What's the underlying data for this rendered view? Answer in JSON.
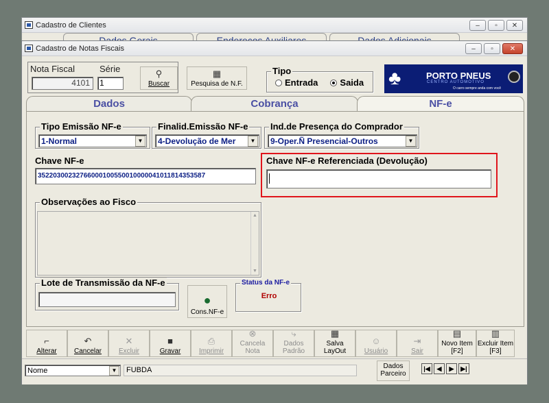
{
  "outer_window": {
    "title": "Cadastro de Clientes",
    "bg_tabs": [
      "Dados Gerais",
      "Endereços Auxiliares",
      "Dados Adicionais"
    ]
  },
  "inner_window": {
    "title": "Cadastro de Notas Fiscais"
  },
  "header": {
    "nota_fiscal_label": "Nota Fiscal",
    "nota_fiscal_value": "4101",
    "serie_label": "Série",
    "serie_value": "1",
    "buscar_label": "Buscar",
    "pesquisa_label": "Pesquisa de N.F.",
    "tipo_label": "Tipo",
    "tipo_options": [
      "Entrada",
      "Saida"
    ],
    "tipo_selected": "Saida",
    "logo_text": "PORTO PNEUS",
    "logo_subtext": "CENTRO AUTOMOTIVO",
    "logo_tagline": "O carro sempre anda com você"
  },
  "tabs": [
    "Dados",
    "Cobrança",
    "NF-e"
  ],
  "active_tab": "NF-e",
  "nfe": {
    "tipo_emissao_label": "Tipo Emissão NF-e",
    "tipo_emissao_value": "1-Normal",
    "finalidade_label": "Finalid.Emissão NF-e",
    "finalidade_value": "4-Devolução de Mer",
    "presenca_label": "Ind.de Presença do Comprador",
    "presenca_value": "9-Oper.Ñ Presencial-Outros",
    "chave_label": "Chave NF-e",
    "chave_value": "35220300232766000100550010000041011814353587",
    "chave_ref_label": "Chave NF-e Referenciada (Devolução)",
    "chave_ref_value": "",
    "observacoes_label": "Observações ao Fisco",
    "lote_label": "Lote de Transmissão da NF-e",
    "lote_value": "",
    "cons_label": "Cons.NF-e",
    "status_label": "Status da NF-e",
    "status_value": "Erro"
  },
  "toolbar": [
    {
      "label": "Alterar",
      "icon": "edit-icon",
      "glyph": "⌐",
      "disabled": false
    },
    {
      "label": "Cancelar",
      "icon": "undo-icon",
      "glyph": "↶",
      "disabled": false
    },
    {
      "label": "Excluir",
      "icon": "delete-icon",
      "glyph": "✕",
      "disabled": true
    },
    {
      "label": "Gravar",
      "icon": "save-icon",
      "glyph": "■",
      "disabled": false
    },
    {
      "label": "Imprimir",
      "icon": "print-icon",
      "glyph": "⎙",
      "disabled": true
    },
    {
      "label": "Cancela Nota",
      "icon": "cancel-note-icon",
      "glyph": "⊗",
      "disabled": true
    },
    {
      "label": "Dados Padrão",
      "icon": "default-data-icon",
      "glyph": "⤷",
      "disabled": true
    },
    {
      "label": "Salva LayOut",
      "icon": "save-layout-icon",
      "glyph": "▦",
      "disabled": false
    },
    {
      "label": "Usuário",
      "icon": "user-icon",
      "glyph": "☺",
      "disabled": true
    },
    {
      "label": "Sair",
      "icon": "exit-icon",
      "glyph": "⇥",
      "disabled": true
    },
    {
      "label": "Novo Item [F2]",
      "icon": "new-item-icon",
      "glyph": "▤",
      "disabled": false
    },
    {
      "label": "Excluir Item [F3]",
      "icon": "delete-item-icon",
      "glyph": "▥",
      "disabled": false
    }
  ],
  "footer": {
    "field_select": "Nome",
    "field_value": "FUBDA",
    "dados_parceiro": "Dados Parceiro"
  },
  "colors": {
    "accent_red": "#e0141b",
    "tab_text": "#4a4fa3",
    "status_error": "#b00000"
  }
}
